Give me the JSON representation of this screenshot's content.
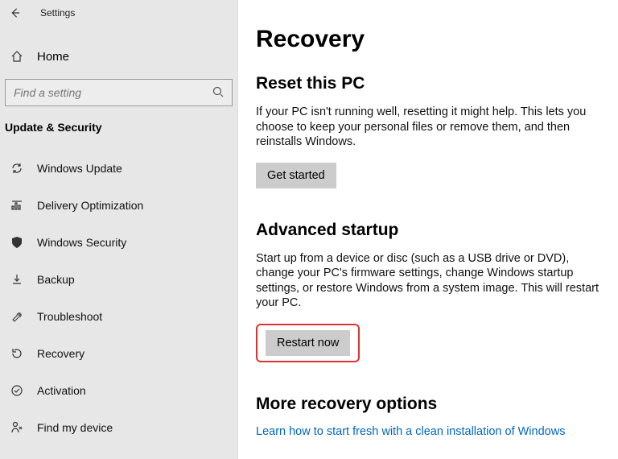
{
  "window": {
    "title": "Settings"
  },
  "home": {
    "label": "Home"
  },
  "search": {
    "placeholder": "Find a setting"
  },
  "section_label": "Update & Security",
  "sidebar": {
    "items": [
      {
        "icon": "sync-icon",
        "label": "Windows Update"
      },
      {
        "icon": "optimize-icon",
        "label": "Delivery Optimization"
      },
      {
        "icon": "shield-icon",
        "label": "Windows Security"
      },
      {
        "icon": "backup-icon",
        "label": "Backup"
      },
      {
        "icon": "troubleshoot-icon",
        "label": "Troubleshoot"
      },
      {
        "icon": "recovery-icon",
        "label": "Recovery"
      },
      {
        "icon": "activation-icon",
        "label": "Activation"
      },
      {
        "icon": "findmydevice-icon",
        "label": "Find my device"
      }
    ]
  },
  "main": {
    "page_title": "Recovery",
    "reset": {
      "heading": "Reset this PC",
      "text": "If your PC isn't running well, resetting it might help. This lets you choose to keep your personal files or remove them, and then reinstalls Windows.",
      "button": "Get started"
    },
    "advanced": {
      "heading": "Advanced startup",
      "text": "Start up from a device or disc (such as a USB drive or DVD), change your PC's firmware settings, change Windows startup settings, or restore Windows from a system image. This will restart your PC.",
      "button": "Restart now"
    },
    "more": {
      "heading": "More recovery options",
      "link": "Learn how to start fresh with a clean installation of Windows"
    }
  }
}
